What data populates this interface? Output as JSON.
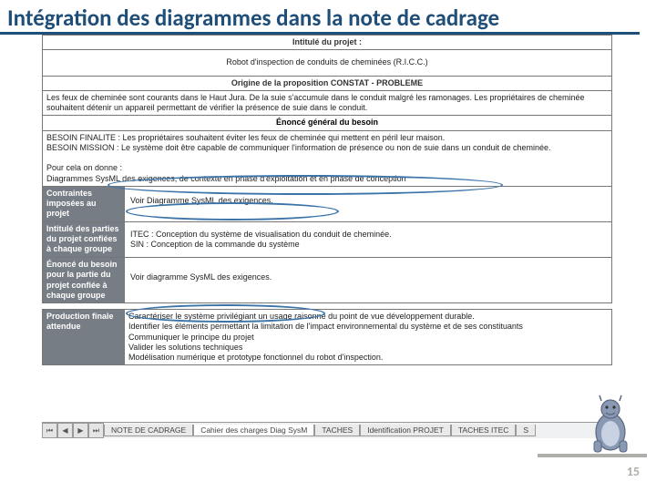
{
  "slide_title": "Intégration des diagrammes dans la note de cadrage",
  "page_number": "15",
  "doc": {
    "hdr1": "Intitulé du projet :",
    "row1": "Robot d'inspection de conduits de cheminées (R.I.C.C.)",
    "hdr2": "Origine de la proposition CONSTAT - PROBLEME",
    "row2": "Les feux de cheminée sont courants dans le Haut Jura. De la suie s'accumule dans le conduit malgré les ramonages. Les propriétaires de cheminée souhaitent détenir un appareil permettant de vérifier la présence de suie dans le conduit.",
    "hdr3": "Énoncé général du besoin",
    "row3a": "BESOIN FINALITE : Les propriétaires souhaitent éviter les feux de cheminée qui mettent en péril leur maison.",
    "row3b": "BESOIN MISSION : Le système doit être capable de communiquer l'information de présence ou non de suie dans un conduit de cheminée.",
    "row3c": "Pour cela on donne :",
    "row3d": "Diagrammes SysML des exigences, de contexte en phase d'exploitation et en phase de conception",
    "side1": "Contraintes imposées au projet",
    "cell1": "Voir Diagramme SysML des exigences.",
    "side2": "Intitulé des parties du projet confiées à chaque groupe",
    "cell2a": "ITEC :   Conception du système de visualisation du conduit de cheminée.",
    "cell2b": "SIN  :   Conception de la commande du système",
    "side3": "Énoncé du besoin pour la partie du projet confiée à chaque groupe",
    "cell3": "Voir diagramme SysML des exigences.",
    "side4": "Production finale attendue",
    "cell4a": "Caractériser le système privilégiant un usage raisonné du point de vue développement durable.",
    "cell4b": "Identifier les éléments permettant la limitation de l'impact environnemental du système et de ses constituants",
    "cell4c": "Communiquer le principe du projet",
    "cell4d": "Valider les solutions techniques",
    "cell4e": "Modélisation numérique et prototype fonctionnel du robot d'inspection."
  },
  "tabs": {
    "t0": "NOTE DE CADRAGE",
    "t1": "Cahier des charges Diag SysM",
    "t2": "TACHES",
    "t3": "Identification PROJET",
    "t4": "TACHES ITEC",
    "t5": "S"
  }
}
